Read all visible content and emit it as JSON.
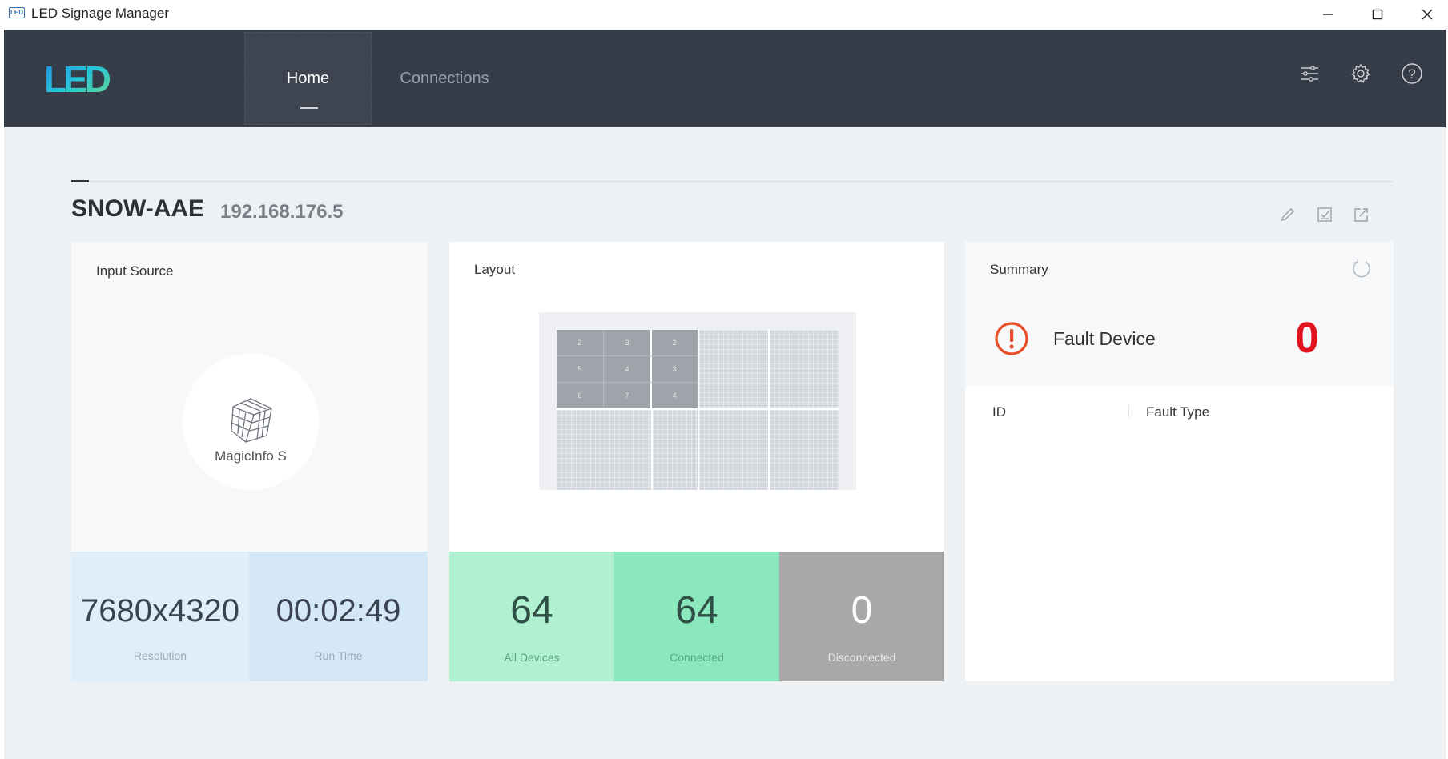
{
  "window": {
    "app_icon_text": "LED",
    "title": "LED Signage Manager"
  },
  "nav": {
    "logo_text": "LED",
    "tabs": [
      {
        "label": "Home",
        "active": true
      },
      {
        "label": "Connections",
        "active": false
      }
    ],
    "icons": [
      "filter-sliders-icon",
      "gear-icon",
      "help-icon"
    ]
  },
  "device": {
    "name": "SNOW-AAE",
    "ip": "192.168.176.5",
    "actions": [
      "edit-icon",
      "check-icon",
      "export-icon"
    ]
  },
  "input_source": {
    "title": "Input Source",
    "source": "MagicInfo S",
    "resolution_value": "7680x4320",
    "resolution_label": "Resolution",
    "runtime_value": "00:02:49",
    "runtime_label": "Run Time"
  },
  "layout": {
    "title": "Layout",
    "cell_numbers": [
      "2",
      "3",
      "2",
      "5",
      "4",
      "3",
      "6",
      "7",
      "4"
    ],
    "all_devices_value": "64",
    "all_devices_label": "All Devices",
    "connected_value": "64",
    "connected_label": "Connected",
    "disconnected_value": "0",
    "disconnected_label": "Disconnected"
  },
  "summary": {
    "title": "Summary",
    "fault_label": "Fault Device",
    "fault_count": "0",
    "columns": [
      "ID",
      "Fault Type"
    ]
  },
  "colors": {
    "nav_bg": "#373d48",
    "content_bg": "#eef1f4",
    "fault_red": "#e0141e",
    "fault_orange": "#e8502a",
    "connected_green": "#8be8bd",
    "all_devices_green": "#b1f0d0",
    "disconnected_gray": "#a8a8a8"
  }
}
